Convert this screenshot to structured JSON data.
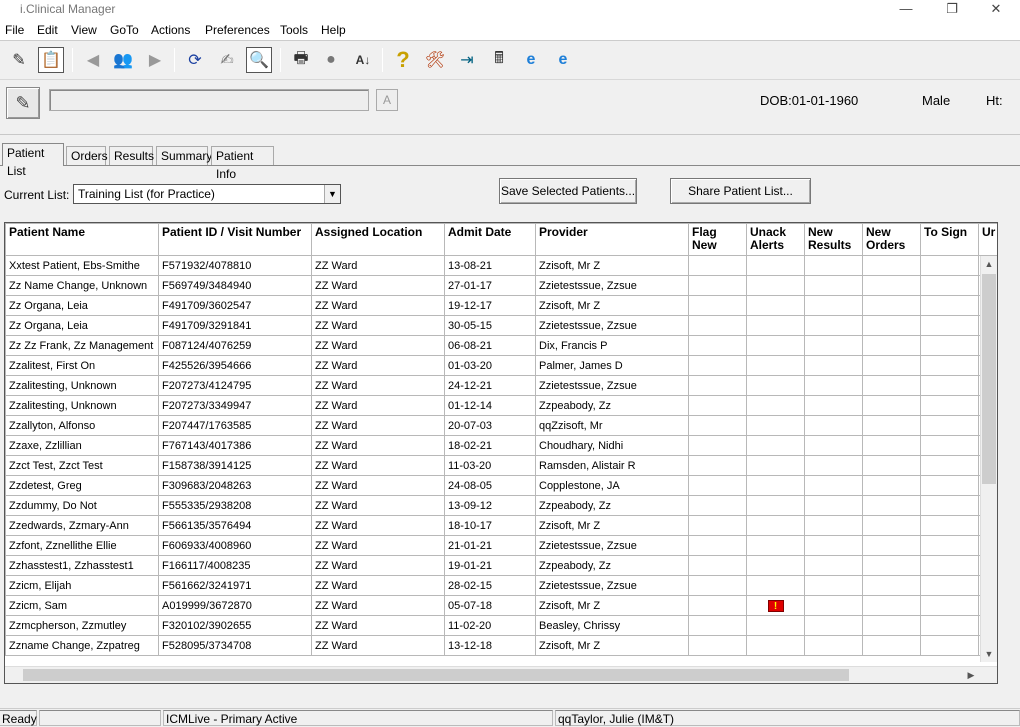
{
  "window": {
    "title": "i.Clinical Manager",
    "controls": [
      "—",
      "❐",
      "✕"
    ]
  },
  "menu": [
    "File",
    "Edit",
    "View",
    "GoTo",
    "Actions",
    "Preferences",
    "Tools",
    "Help"
  ],
  "toolbar_icons": [
    "notes-icon",
    "edit-notes-icon",
    "back-icon",
    "people-icon",
    "forward-icon",
    "refresh-icon",
    "document-edit-icon",
    "find-patient-icon",
    "printer-icon",
    "record-icon",
    "sort-az-icon",
    "help-icon",
    "tools-icon",
    "exit-icon",
    "calculator-icon",
    "ie-icon",
    "ie-icon-2"
  ],
  "patient_bar": {
    "a_button": "A",
    "dob": "DOB:01-01-1960",
    "sex": "Male",
    "height": "Ht:"
  },
  "tabs": [
    "Patient List",
    "Orders",
    "Results",
    "Summary",
    "Patient Info"
  ],
  "current_list": {
    "label": "Current List:",
    "value": "Training List (for Practice)"
  },
  "buttons": {
    "save_selected": "Save Selected Patients...",
    "share_list": "Share Patient List..."
  },
  "columns": [
    "Patient Name",
    "Patient ID / Visit Number",
    "Assigned Location",
    "Admit Date",
    "Provider",
    "Flag New",
    "Unack Alerts",
    "New Results",
    "New Orders",
    "To Sign",
    "Ur"
  ],
  "rows": [
    [
      "Xxtest Patient, Ebs-Smithe",
      "F571932/4078810",
      "ZZ Ward",
      "13-08-21",
      "Zzisoft, Mr Z"
    ],
    [
      "Zz Name Change, Unknown",
      "F569749/3484940",
      "ZZ Ward",
      "27-01-17",
      "Zzietestssue, Zzsue"
    ],
    [
      "Zz Organa, Leia",
      "F491709/3602547",
      "ZZ Ward",
      "19-12-17",
      "Zzisoft, Mr Z"
    ],
    [
      "Zz Organa, Leia",
      "F491709/3291841",
      "ZZ Ward",
      "30-05-15",
      "Zzietestssue, Zzsue"
    ],
    [
      "Zz Zz Frank, Zz Management",
      "F087124/4076259",
      "ZZ Ward",
      "06-08-21",
      "Dix, Francis P"
    ],
    [
      "Zzalitest, First On",
      "F425526/3954666",
      "ZZ Ward",
      "01-03-20",
      "Palmer, James D"
    ],
    [
      "Zzalitesting, Unknown",
      "F207273/4124795",
      "ZZ Ward",
      "24-12-21",
      "Zzietestssue, Zzsue"
    ],
    [
      "Zzalitesting, Unknown",
      "F207273/3349947",
      "ZZ Ward",
      "01-12-14",
      "Zzpeabody, Zz"
    ],
    [
      "Zzallyton, Alfonso",
      "F207447/1763585",
      "ZZ Ward",
      "20-07-03",
      "qqZzisoft, Mr"
    ],
    [
      "Zzaxe, Zzlillian",
      "F767143/4017386",
      "ZZ Ward",
      "18-02-21",
      "Choudhary, Nidhi"
    ],
    [
      "Zzct Test, Zzct Test",
      "F158738/3914125",
      "ZZ Ward",
      "11-03-20",
      "Ramsden, Alistair R"
    ],
    [
      "Zzdetest, Greg",
      "F309683/2048263",
      "ZZ Ward",
      "24-08-05",
      "Copplestone, JA"
    ],
    [
      "Zzdummy, Do Not",
      "F555335/2938208",
      "ZZ Ward",
      "13-09-12",
      "Zzpeabody, Zz"
    ],
    [
      "Zzedwards, Zzmary-Ann",
      "F566135/3576494",
      "ZZ Ward",
      "18-10-17",
      "Zzisoft, Mr Z"
    ],
    [
      "Zzfont, Zznellithe Ellie",
      "F606933/4008960",
      "ZZ Ward",
      "21-01-21",
      "Zzietestssue, Zzsue"
    ],
    [
      "Zzhasstest1, Zzhasstest1",
      "F166117/4008235",
      "ZZ Ward",
      "19-01-21",
      "Zzpeabody, Zz"
    ],
    [
      "Zzicm, Elijah",
      "F561662/3241971",
      "ZZ Ward",
      "28-02-15",
      "Zzietestssue, Zzsue"
    ],
    [
      "Zzicm, Sam",
      "A019999/3672870",
      "ZZ Ward",
      "05-07-18",
      "Zzisoft, Mr Z"
    ],
    [
      "Zzmcpherson, Zzmutley",
      "F320102/3902655",
      "ZZ Ward",
      "11-02-20",
      "Beasley, Chrissy"
    ],
    [
      "Zzname Change, Zzpatreg",
      "F528095/3734708",
      "ZZ Ward",
      "13-12-18",
      "Zzisoft, Mr Z"
    ]
  ],
  "alert_flag": {
    "row": 17,
    "label": "!"
  },
  "status": {
    "ready": "Ready",
    "env": "ICMLive - Primary Active",
    "user": "qqTaylor, Julie (IM&T)"
  }
}
